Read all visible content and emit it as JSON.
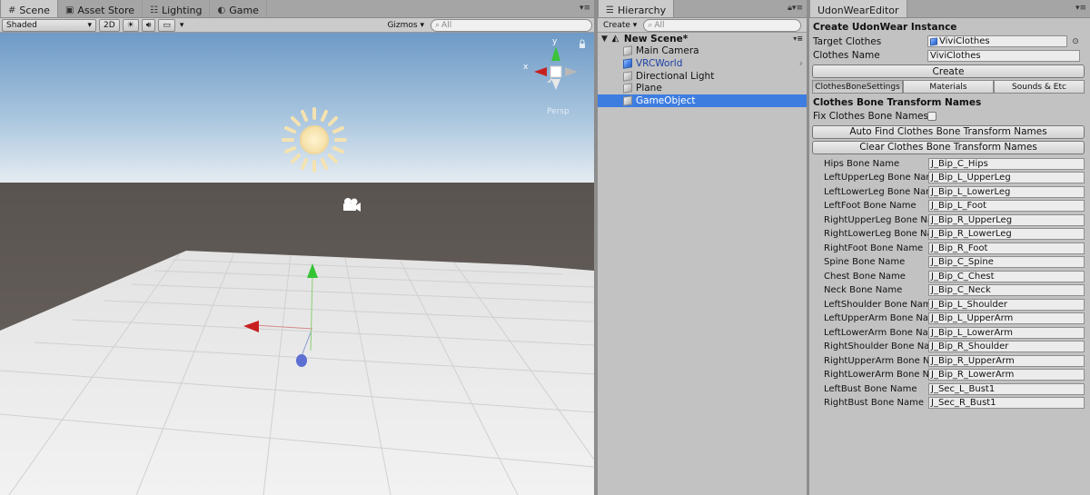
{
  "scene": {
    "tabs": [
      {
        "label": "Scene",
        "icon": "grid-icon"
      },
      {
        "label": "Asset Store",
        "icon": "shop-icon"
      },
      {
        "label": "Lighting",
        "icon": "lighting-icon"
      },
      {
        "label": "Game",
        "icon": "game-icon"
      }
    ],
    "shading_mode": "Shaded",
    "mode_2d": "2D",
    "gizmos_label": "Gizmos",
    "search_placeholder": "All",
    "persp_label": "Persp"
  },
  "hierarchy": {
    "tab_label": "Hierarchy",
    "create_label": "Create",
    "search_placeholder": "All",
    "root": "New Scene*",
    "items": [
      {
        "label": "Main Camera",
        "type": "object"
      },
      {
        "label": "VRCWorld",
        "type": "prefab"
      },
      {
        "label": "Directional Light",
        "type": "object"
      },
      {
        "label": "Plane",
        "type": "object"
      },
      {
        "label": "GameObject",
        "type": "object",
        "selected": true
      }
    ]
  },
  "inspector": {
    "tab_label": "UdonWearEditor",
    "title": "Create UdonWear Instance",
    "target_clothes_label": "Target Clothes",
    "target_clothes_value": "ViviClothes",
    "clothes_name_label": "Clothes Name",
    "clothes_name_value": "ViviClothes",
    "create_button": "Create",
    "tabs": [
      "ClothesBoneSettings",
      "Materials",
      "Sounds & Etc"
    ],
    "section_title": "Clothes Bone Transform Names",
    "fix_label": "Fix Clothes Bone Names",
    "auto_find_button": "Auto Find Clothes Bone Transform Names",
    "clear_button": "Clear Clothes Bone Transform Names",
    "bones": [
      {
        "label": "Hips Bone Name",
        "value": "J_Bip_C_Hips"
      },
      {
        "label": "LeftUpperLeg Bone Name",
        "value": "J_Bip_L_UpperLeg"
      },
      {
        "label": "LeftLowerLeg Bone Name",
        "value": "J_Bip_L_LowerLeg"
      },
      {
        "label": "LeftFoot Bone Name",
        "value": "J_Bip_L_Foot"
      },
      {
        "label": "RightUpperLeg Bone Name",
        "value": "J_Bip_R_UpperLeg"
      },
      {
        "label": "RightLowerLeg Bone Name",
        "value": "J_Bip_R_LowerLeg"
      },
      {
        "label": "RightFoot Bone Name",
        "value": "J_Bip_R_Foot"
      },
      {
        "label": "Spine Bone Name",
        "value": "J_Bip_C_Spine"
      },
      {
        "label": "Chest Bone Name",
        "value": "J_Bip_C_Chest"
      },
      {
        "label": "Neck Bone Name",
        "value": "J_Bip_C_Neck"
      },
      {
        "label": "LeftShoulder Bone Name",
        "value": "J_Bip_L_Shoulder"
      },
      {
        "label": "LeftUpperArm Bone Name",
        "value": "J_Bip_L_UpperArm"
      },
      {
        "label": "LeftLowerArm Bone Name",
        "value": "J_Bip_L_LowerArm"
      },
      {
        "label": "RightShoulder Bone Name",
        "value": "J_Bip_R_Shoulder"
      },
      {
        "label": "RightUpperArm Bone Name",
        "value": "J_Bip_R_UpperArm"
      },
      {
        "label": "RightLowerArm Bone Name",
        "value": "J_Bip_R_LowerArm"
      },
      {
        "label": "LeftBust Bone Name",
        "value": "J_Sec_L_Bust1"
      },
      {
        "label": "RightBust Bone Name",
        "value": "J_Sec_R_Bust1"
      }
    ]
  }
}
